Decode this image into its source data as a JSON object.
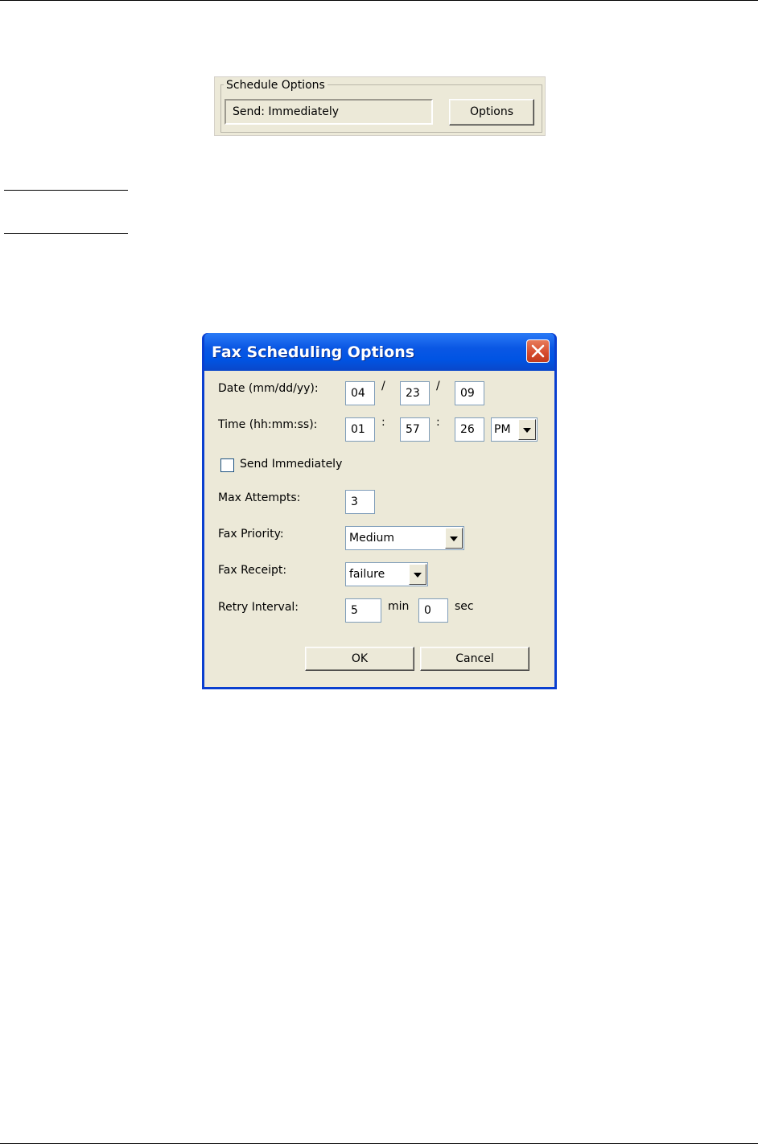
{
  "schedule_group": {
    "legend": "Schedule Options",
    "status_text": "Send: Immediately",
    "options_button": "Options"
  },
  "dialog": {
    "title": "Fax Scheduling Options",
    "date": {
      "label": "Date (mm/dd/yy):",
      "month": "04",
      "day": "23",
      "year": "09",
      "separator": "/"
    },
    "time": {
      "label": "Time (hh:mm:ss):",
      "hours": "01",
      "minutes": "57",
      "seconds": "26",
      "separator": ":",
      "ampm": "PM"
    },
    "send_immediately": {
      "label": "Send Immediately",
      "checked": false
    },
    "max_attempts": {
      "label": "Max Attempts:",
      "value": "3"
    },
    "fax_priority": {
      "label": "Fax Priority:",
      "value": "Medium"
    },
    "fax_receipt": {
      "label": "Fax Receipt:",
      "value": "failure"
    },
    "retry_interval": {
      "label": "Retry Interval:",
      "minutes": "5",
      "minutes_unit": "min",
      "seconds": "0",
      "seconds_unit": "sec"
    },
    "buttons": {
      "ok": "OK",
      "cancel": "Cancel"
    }
  },
  "colors": {
    "dialog_face": "#ece9d8",
    "titlebar_blue": "#0054e3",
    "close_red": "#d54a2c",
    "field_border": "#7f9db9"
  }
}
